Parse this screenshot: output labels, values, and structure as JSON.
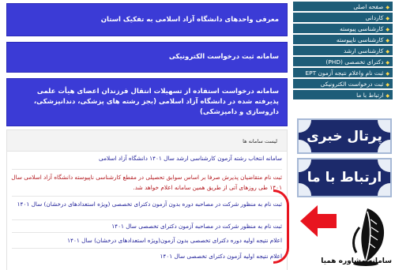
{
  "main": {
    "box1": "معرفی واحدهای دانشگاه آزاد اسلامی به تفکیک استان",
    "box2": "سامانه ثبت درخواست الکترونیکی",
    "box3": "سامانه درخواست استفاده از تسهیلات انتقال فرزندان اعضای هیأت علمی پذیرفته شده در دانشگاه آزاد اسلامی (بجز رشته های پزشکی، دندانپزشکی، داروسازی و دامپزشکی)",
    "sites_header": "لیست سامانه ها",
    "news": [
      "سامانه انتخاب رشته آزمون کارشناسی ارشد سال ۱۴۰۱ دانشگاه آزاد اسلامی",
      "ثبت نام متقاضیان پذیرش صرفا بر اساس سوابق تحصیلی در مقطع کارشناسی ناپیوسته دانشگاه آزاد اسلامی سال ۱۴۰۱ طی روزهای آتی از طریق همین سامانه اعلام خواهد شد.",
      "ثبت نام به منظور شرکت در مصاحبه دوره بدون آزمون دکترای تخصصی (ویژه استعدادهای درخشان) سال ۱۴۰۱",
      "ثبت نام به منظور شرکت در مصاحبه آزمون دکترای تخصصی سال ۱۴۰۱",
      "اعلام نتیجه اولیه دوره دکترای تخصصی بدون آزمون(ویژه استعدادهای درخشان) سال ۱۴۰۱",
      "اعلام نتیجه اولیه آزمون دکترای تخصصی سال ۱۴۰۱"
    ]
  },
  "sidebar": {
    "items": [
      "صفحه اصلی",
      "کاردانی",
      "کارشناسی پیوسته",
      "کارشناسی ناپیوسته",
      "کارشناسی ارشد",
      "دکترای تخصصی (PHD)",
      "ثبت نام واعلام نتیجه آزمون EPT",
      "ثبت درخواست الکترونیکی",
      "ارتباط با ما"
    ]
  },
  "banners": {
    "news_portal": "پرتال خبری",
    "contact": "ارتباط با ما"
  },
  "logo": {
    "text": "سامانه مشاوره همیا"
  },
  "colors": {
    "box_blue": "#3b3bd6",
    "sidebar_teal": "#1e5d78",
    "link_blue": "#22229a",
    "link_red": "#b3171d",
    "highlight_red": "#e8141f"
  }
}
